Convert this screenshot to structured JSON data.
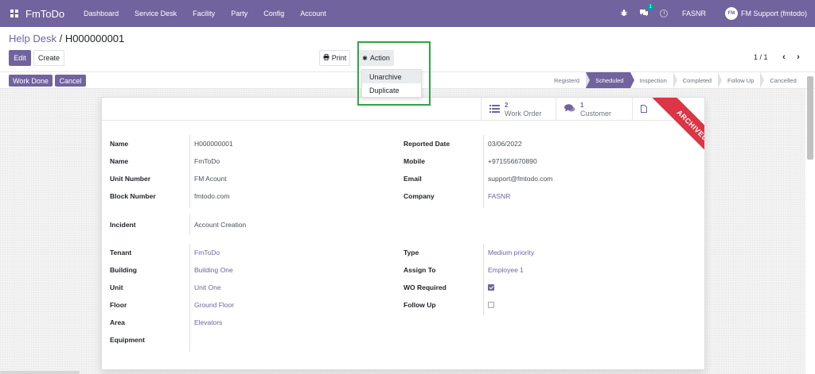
{
  "navbar": {
    "brand": "FmToDo",
    "menu": [
      "Dashboard",
      "Service Desk",
      "Facility",
      "Party",
      "Config",
      "Account"
    ],
    "chat_badge": "1",
    "company": "FASNR",
    "avatar_text": "FM",
    "user": "FM Support (fmtodo)"
  },
  "breadcrumb": {
    "parent": "Help Desk",
    "separator": " / ",
    "current": "H000000001"
  },
  "buttons": {
    "edit": "Edit",
    "create": "Create",
    "print": "Print",
    "action": "Action",
    "work_done": "Work Done",
    "cancel": "Cancel"
  },
  "pager": {
    "text": "1 / 1"
  },
  "action_menu": [
    "Unarchive",
    "Duplicate"
  ],
  "stages": [
    {
      "label": "Registerd",
      "active": false
    },
    {
      "label": "Scheduled",
      "active": true
    },
    {
      "label": "Inspection",
      "active": false
    },
    {
      "label": "Completed",
      "active": false
    },
    {
      "label": "Follow Up",
      "active": false
    },
    {
      "label": "Cancelled",
      "active": false
    }
  ],
  "smart_buttons": {
    "work_order": {
      "count": "2",
      "label": "Work Order"
    },
    "customer": {
      "count": "1",
      "label": "Customer"
    }
  },
  "ribbon": "ARCHIVED",
  "colors": {
    "brand": "#71639e",
    "ribbon": "#dc3545",
    "highlight": "#2ea642"
  },
  "form": {
    "left_top": [
      {
        "label": "Name",
        "value": "H000000001"
      },
      {
        "label": "Name",
        "value": "FmToDo"
      },
      {
        "label": "Unit Number",
        "value": "FM Acount"
      },
      {
        "label": "Block Number",
        "value": "fmtodo.com"
      }
    ],
    "right_top": [
      {
        "label": "Reported Date",
        "value": "03/06/2022"
      },
      {
        "label": "Mobile",
        "value": "+971556670890"
      },
      {
        "label": "Email",
        "value": "support@fmtodo.com"
      },
      {
        "label": "Company",
        "value": "FASNR"
      }
    ],
    "incident": {
      "label": "Incident",
      "value": "Account Creation"
    },
    "left_bottom": [
      {
        "label": "Tenant",
        "value": "FmToDo"
      },
      {
        "label": "Building",
        "value": "Building One"
      },
      {
        "label": "Unit",
        "value": "Unit One"
      },
      {
        "label": "Floor",
        "value": "Ground Floor"
      },
      {
        "label": "Area",
        "value": "Elevators"
      },
      {
        "label": "Equipment",
        "value": ""
      }
    ],
    "right_bottom": [
      {
        "label": "Type",
        "value": "Medium priority"
      },
      {
        "label": "Assign To",
        "value": "Employee 1"
      },
      {
        "label": "WO Required",
        "value": true
      },
      {
        "label": "Follow Up",
        "value": false
      }
    ]
  }
}
